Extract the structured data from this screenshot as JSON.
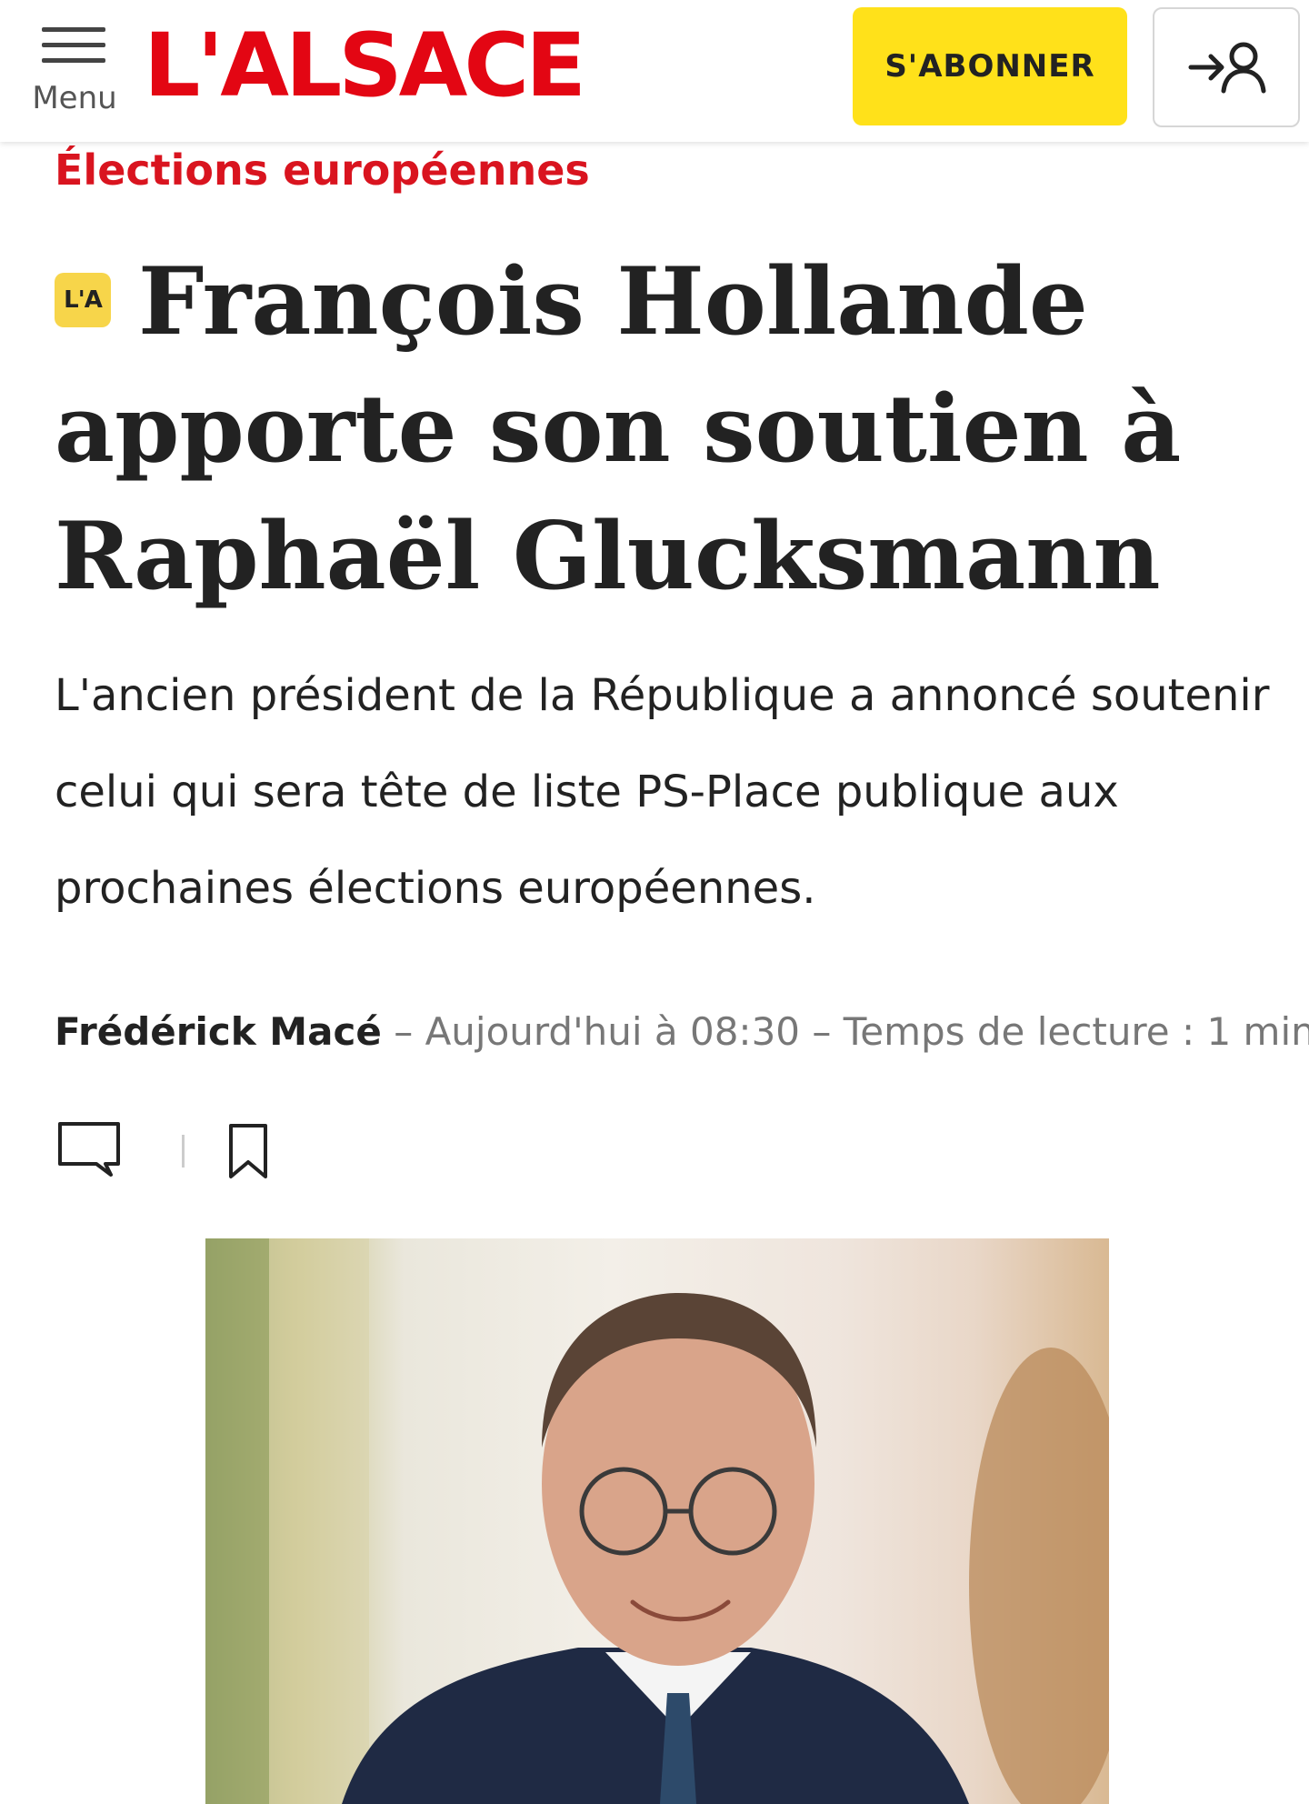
{
  "header": {
    "menu_label": "Menu",
    "logo_text": "L'ALSACE",
    "subscribe_label": "S'ABONNER",
    "login_icon": "login-user-icon",
    "brand_color": "#e30613",
    "subscribe_color": "#ffe11a"
  },
  "article": {
    "section": "Élections européennes",
    "badge": "L'A",
    "title": "François Hollande apporte son soutien à Raphaël Glucksmann",
    "lead": "L'ancien président de la République a annoncé soutenir celui qui sera tête de liste PS-Place publique aux prochaines élections européennes.",
    "author": "Frédérick Macé",
    "date": "Aujourd'hui à 08:30",
    "reading_time": "Temps de lecture : 1 min",
    "separator": "–",
    "actions": {
      "comment_icon": "comment-icon",
      "bookmark_icon": "bookmark-icon"
    }
  }
}
